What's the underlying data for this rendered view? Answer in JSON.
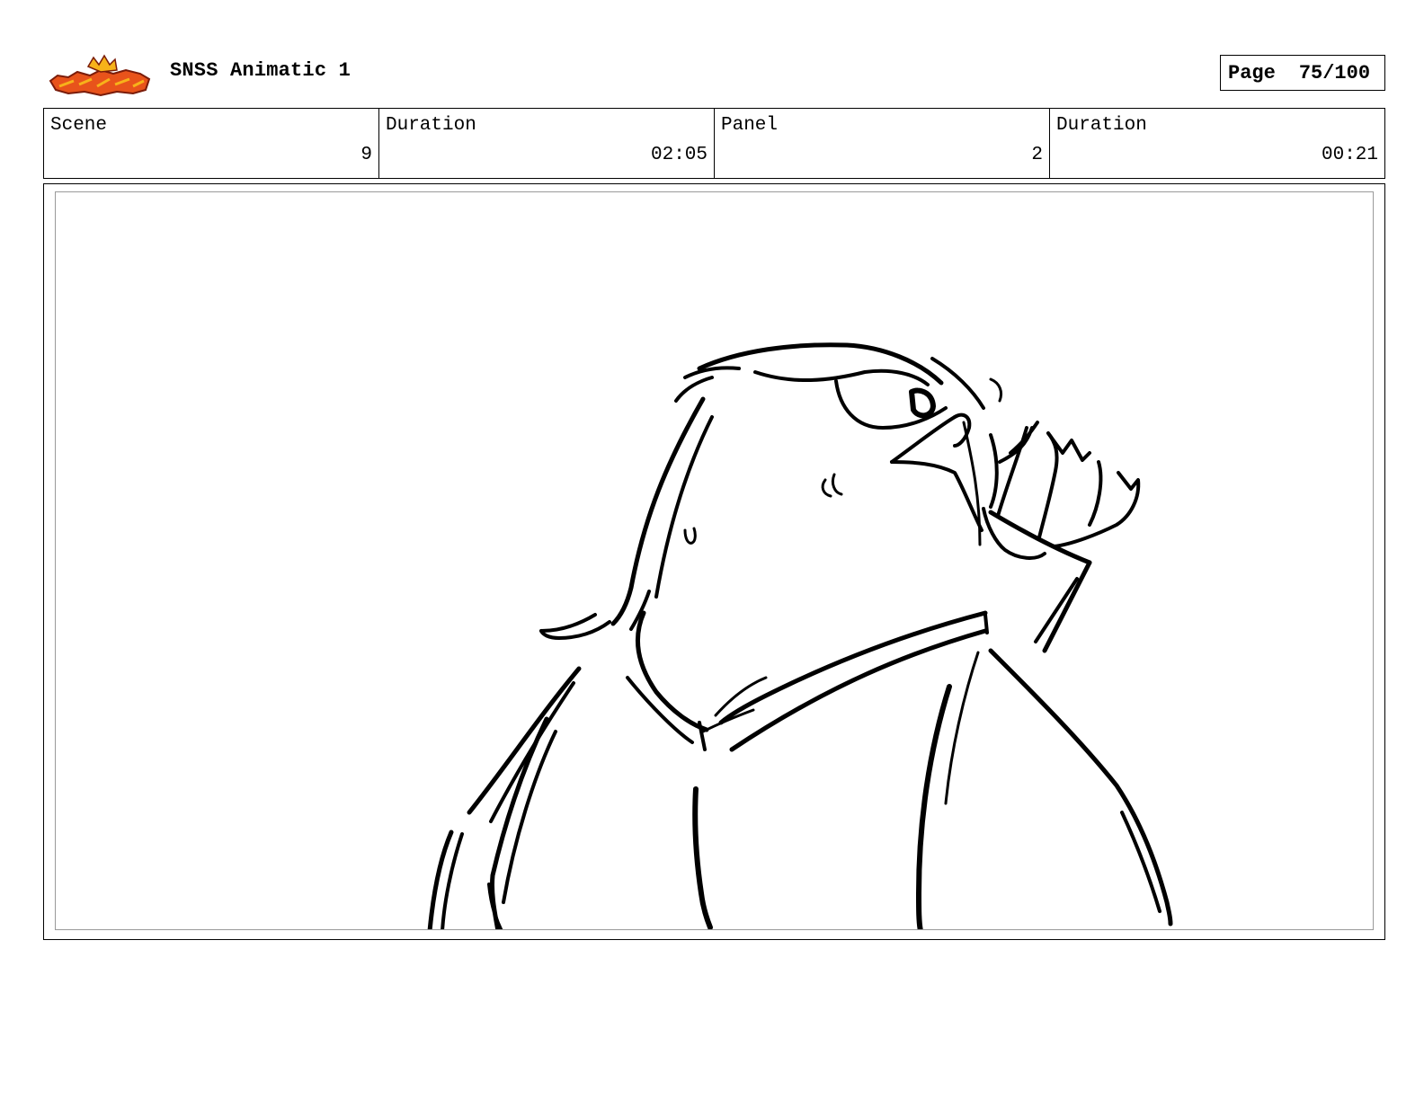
{
  "header": {
    "logo_name": "show-logo",
    "logo_colors": {
      "primary": "#e8531b",
      "secondary": "#f7b21a",
      "outline": "#7a1c0a"
    },
    "project_title": "SNSS Animatic 1",
    "page_label": "Page",
    "page_value": "75/100"
  },
  "info": {
    "scene_label": "Scene",
    "scene_value": "9",
    "scene_duration_label": "Duration",
    "scene_duration_value": "02:05",
    "panel_label": "Panel",
    "panel_value": "2",
    "panel_duration_label": "Duration",
    "panel_duration_value": "00:21"
  },
  "panel": {
    "image_name": "eagle-sketch",
    "line_color": "#000000",
    "frame_color": "#9a9a9a"
  }
}
